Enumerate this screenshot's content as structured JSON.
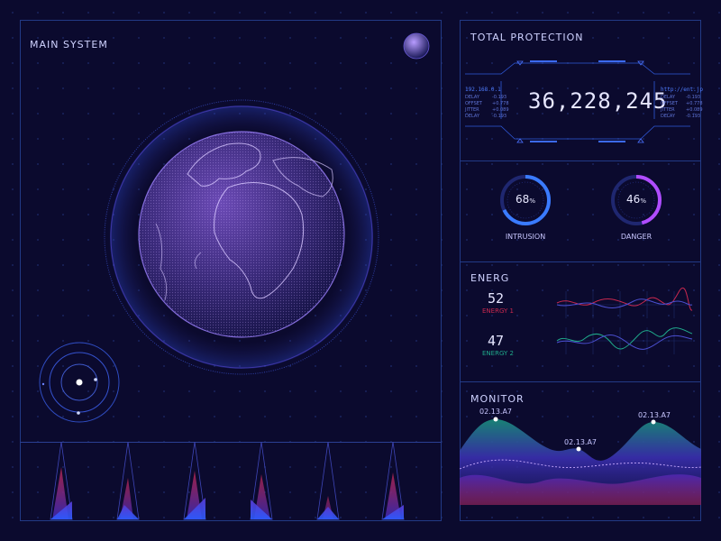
{
  "main": {
    "title": "MAIN SYSTEM"
  },
  "protection": {
    "title": "TOTAL PROTECTION",
    "value": "36,228,245",
    "left_ip": "192.168.0.1",
    "right_host": "http://ent.jp",
    "left_rows": [
      "DELAY",
      "OFFSET",
      "JITTER",
      "DELAY"
    ],
    "left_vals": [
      "-0.193",
      "+0.778",
      "+0.089",
      "-0.193"
    ],
    "right_rows": [
      "DELAY",
      "OFFSET",
      "JITTER",
      "DELAY"
    ],
    "right_vals": [
      "-0.193",
      "+0.778",
      "+0.089",
      "-0.193"
    ]
  },
  "gauges": [
    {
      "label": "INTRUSION",
      "value": "68",
      "unit": "%",
      "fraction": 0.68,
      "color": "#3a7bff"
    },
    {
      "label": "DANGER",
      "value": "46",
      "unit": "%",
      "fraction": 0.46,
      "color": "#b04cff"
    }
  ],
  "energy": {
    "title": "ENERG",
    "items": [
      {
        "value": "52",
        "label": "ENERGY 1",
        "color": "#c8284f"
      },
      {
        "value": "47",
        "label": "ENERGY 2",
        "color": "#1fa88a"
      }
    ]
  },
  "monitor": {
    "title": "MONITOR",
    "tags": [
      "02.13.A7",
      "02.13.A7",
      "02.13.A7"
    ]
  },
  "colors": {
    "accent_blue": "#3a7bff",
    "accent_purple": "#b04cff",
    "panel_border": "#223a86",
    "background": "#0b0a2e"
  }
}
